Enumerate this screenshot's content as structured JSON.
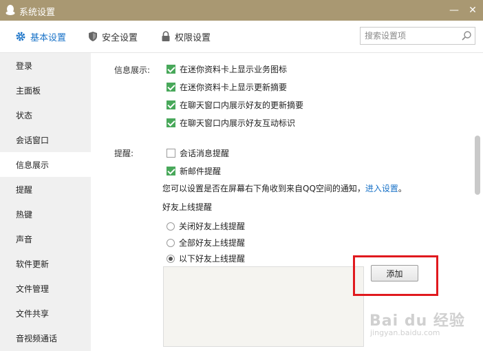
{
  "window": {
    "title": "系统设置",
    "minimize_label": "—",
    "close_label": "✕"
  },
  "topnav": {
    "tabs": [
      {
        "label": "基本设置",
        "icon": "gear-icon",
        "active": true
      },
      {
        "label": "安全设置",
        "icon": "shield-icon",
        "active": false
      },
      {
        "label": "权限设置",
        "icon": "lock-icon",
        "active": false
      }
    ],
    "search_placeholder": "搜索设置项"
  },
  "sidebar": {
    "items": [
      {
        "label": "登录",
        "active": false
      },
      {
        "label": "主面板",
        "active": false
      },
      {
        "label": "状态",
        "active": false
      },
      {
        "label": "会话窗口",
        "active": false
      },
      {
        "label": "信息展示",
        "active": true
      },
      {
        "label": "提醒",
        "active": false
      },
      {
        "label": "热键",
        "active": false
      },
      {
        "label": "声音",
        "active": false
      },
      {
        "label": "软件更新",
        "active": false
      },
      {
        "label": "文件管理",
        "active": false
      },
      {
        "label": "文件共享",
        "active": false
      },
      {
        "label": "音视频通话",
        "active": false
      }
    ]
  },
  "info_display": {
    "label": "信息展示:",
    "options": [
      {
        "label": "在迷你资料卡上显示业务图标",
        "checked": true
      },
      {
        "label": "在迷你资料卡上显示更新摘要",
        "checked": true
      },
      {
        "label": "在聊天窗口内展示好友的更新摘要",
        "checked": true
      },
      {
        "label": "在聊天窗口内展示好友互动标识",
        "checked": true
      }
    ]
  },
  "reminder": {
    "label": "提醒:",
    "options": [
      {
        "label": "会话消息提醒",
        "checked": false
      },
      {
        "label": "新邮件提醒",
        "checked": true
      }
    ],
    "notice_text": "您可以设置是否在屏幕右下角收到来自QQ空间的通知，",
    "notice_link": "进入设置",
    "notice_end": "。",
    "friend_online_title": "好友上线提醒",
    "radios": [
      {
        "label": "关闭好友上线提醒",
        "checked": false
      },
      {
        "label": "全部好友上线提醒",
        "checked": false
      },
      {
        "label": "以下好友上线提醒",
        "checked": true
      }
    ],
    "add_button": "添加"
  },
  "watermark": {
    "main": "Bai du 经验",
    "sub": "jingyan.baidu.com"
  },
  "colors": {
    "titlebar": "#a99872",
    "accent": "#1a73c8",
    "check_green": "#48a85a",
    "highlight_red": "#e0191e"
  }
}
